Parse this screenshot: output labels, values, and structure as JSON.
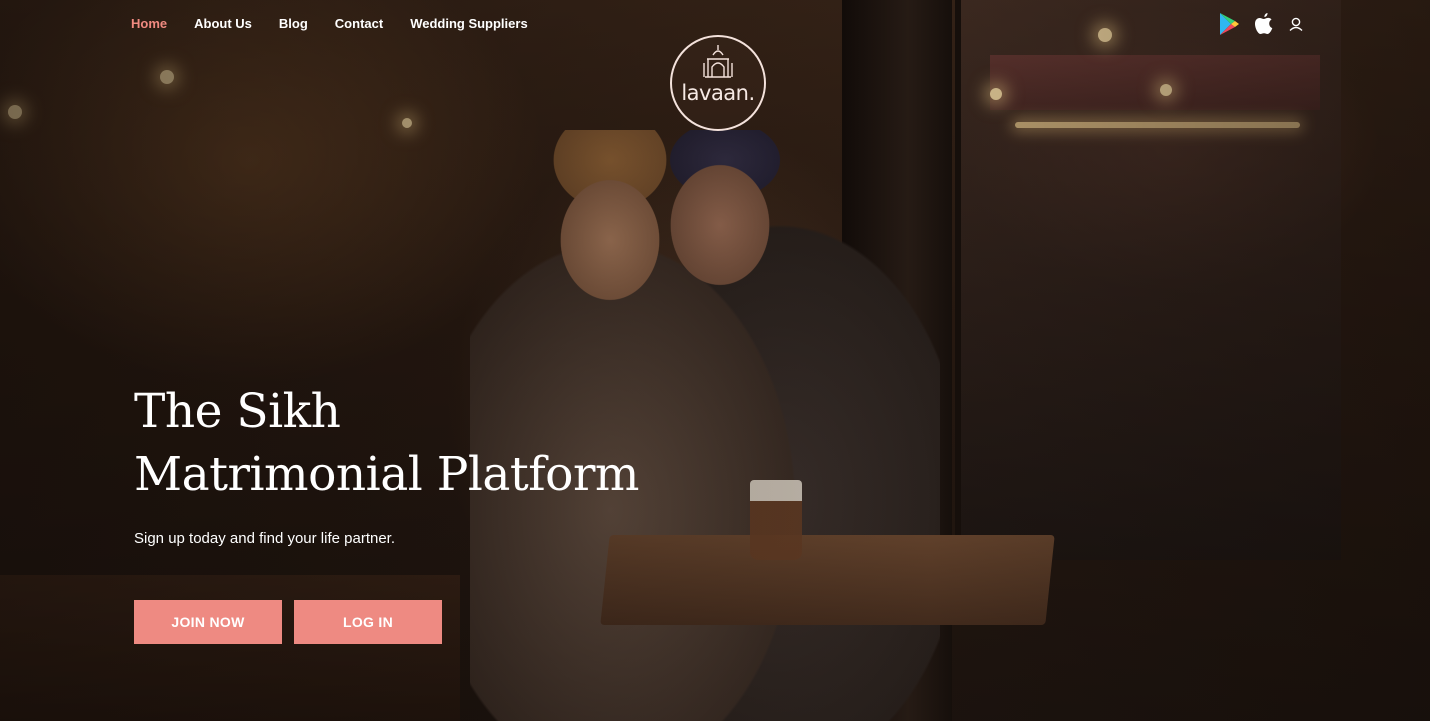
{
  "nav": {
    "items": [
      {
        "label": "Home",
        "active": true
      },
      {
        "label": "About Us",
        "active": false
      },
      {
        "label": "Blog",
        "active": false
      },
      {
        "label": "Contact",
        "active": false
      },
      {
        "label": "Wedding Suppliers",
        "active": false
      }
    ]
  },
  "logo": {
    "text": "lavaan."
  },
  "header_icons": {
    "google_play": "google-play-icon",
    "apple": "apple-icon",
    "user": "user-icon"
  },
  "hero": {
    "headline_line1": "The Sikh",
    "headline_line2": "Matrimonial Platform",
    "subtitle": "Sign up today and find your life partner.",
    "join_label": "JOIN NOW",
    "login_label": "LOG IN"
  },
  "colors": {
    "accent": "#ee8a82",
    "nav_active": "#f08a80",
    "text": "#ffffff"
  }
}
